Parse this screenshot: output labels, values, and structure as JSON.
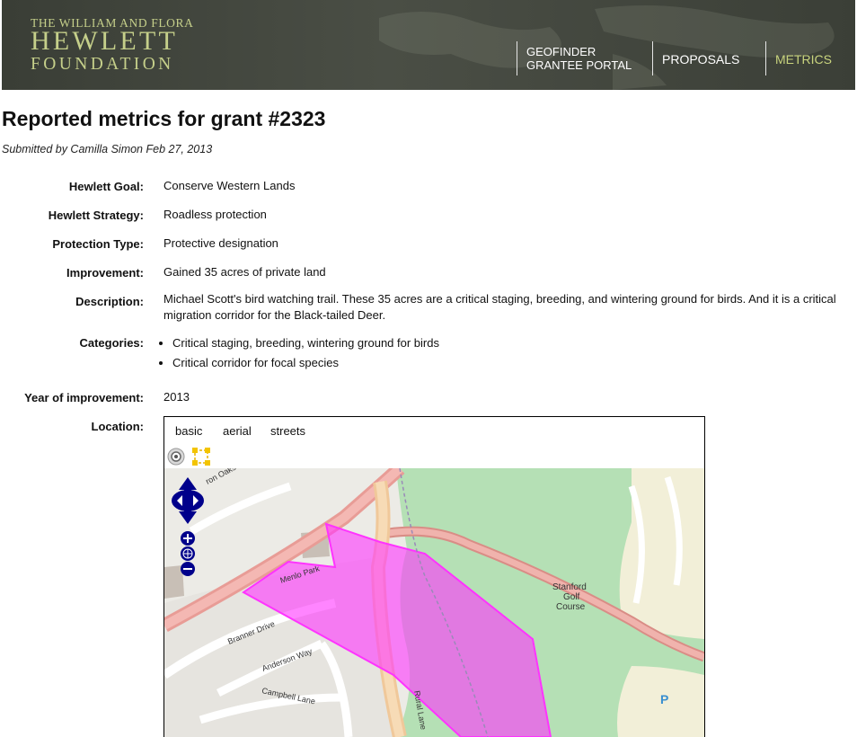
{
  "header": {
    "logo": {
      "line1": "THE WILLIAM AND FLORA",
      "line2": "HEWLETT",
      "line3": "FOUNDATION"
    },
    "nav": [
      {
        "line1": "GEOFINDER",
        "line2": "GRANTEE PORTAL"
      },
      {
        "label": "PROPOSALS"
      },
      {
        "label": "METRICS",
        "active": true
      }
    ]
  },
  "page": {
    "title": "Reported metrics for grant #2323",
    "submitted": "Submitted by Camilla Simon Feb 27, 2013"
  },
  "fields": {
    "goal": {
      "label": "Hewlett Goal:",
      "value": "Conserve Western Lands"
    },
    "strategy": {
      "label": "Hewlett Strategy:",
      "value": "Roadless protection"
    },
    "protection": {
      "label": "Protection Type:",
      "value": "Protective designation"
    },
    "improvement": {
      "label": "Improvement:",
      "value": "Gained 35 acres of private land"
    },
    "description": {
      "label": "Description:",
      "value": "Michael Scott's bird watching trail. These 35 acres are a critical staging, breeding, and wintering ground for birds. And it is a critical migration corridor for the Black-tailed Deer."
    },
    "categories": {
      "label": "Categories:",
      "items": [
        "Critical staging, breeding, wintering ground for birds",
        "Critical corridor for focal species"
      ]
    },
    "year": {
      "label": "Year of improvement:",
      "value": "2013"
    },
    "location": {
      "label": "Location:"
    }
  },
  "map": {
    "tabs": [
      "basic",
      "aerial",
      "streets"
    ],
    "labels": {
      "oaks": "ron Oaks Drive",
      "menlo": "Menlo Park",
      "stanford1": "Stanford",
      "stanford2": "Golf",
      "stanford3": "Course",
      "branner": "Branner Drive",
      "anderson": "Anderson Way",
      "campbell": "Campbell Lane",
      "rural": "Rural Lane",
      "parking": "P"
    },
    "colors": {
      "polygon": "#ff33ff",
      "park": "#b5e0b5",
      "road": "#e8a3a0"
    }
  }
}
